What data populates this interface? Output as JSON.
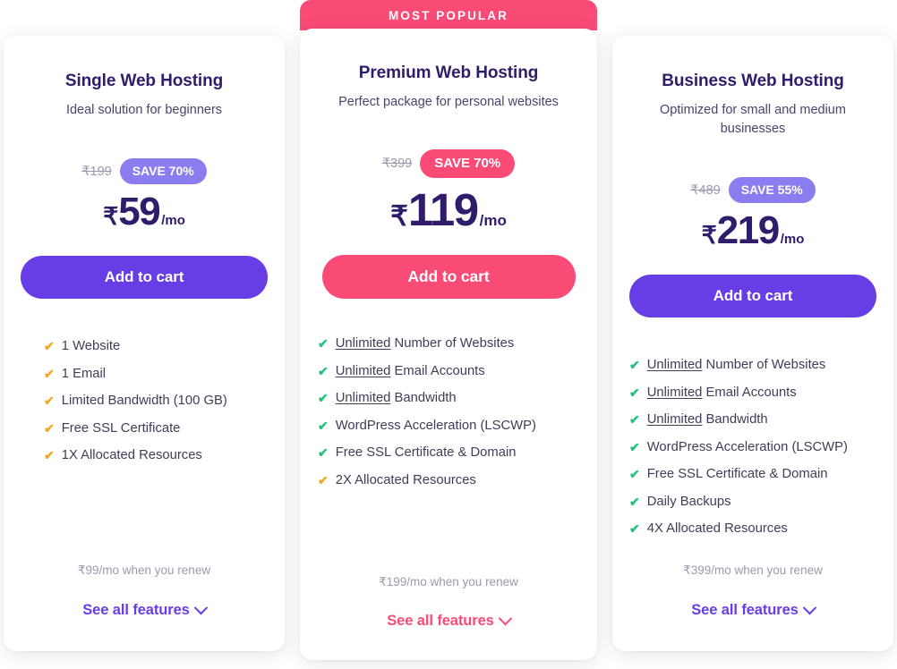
{
  "featured_ribbon": "MOST POPULAR",
  "colors": {
    "purple": "#673de6",
    "light_purple": "#8b7cf0",
    "pink": "#fa4b77",
    "title_navy": "#2f1c6a",
    "green_check": "#21c37a",
    "orange_check": "#f5a623",
    "muted": "#9a9ab0"
  },
  "plans": [
    {
      "id": "single",
      "title": "Single Web Hosting",
      "subtitle": "Ideal solution for beginners",
      "old_price": "₹199",
      "save_badge": "SAVE 70%",
      "currency": "₹",
      "amount": "59",
      "period": "/mo",
      "cta": "Add to cart",
      "features": [
        {
          "text": "1 Website",
          "emphasis": "",
          "check": "orange"
        },
        {
          "text": "1 Email",
          "emphasis": "",
          "check": "orange"
        },
        {
          "text": "Limited Bandwidth (100 GB)",
          "emphasis": "",
          "check": "orange"
        },
        {
          "text": "Free SSL Certificate",
          "emphasis": "",
          "check": "orange"
        },
        {
          "text": "1X Allocated Resources",
          "emphasis": "",
          "check": "orange"
        }
      ],
      "renew": "₹99/mo when you renew",
      "see_all": "See all features"
    },
    {
      "id": "premium",
      "title": "Premium Web Hosting",
      "subtitle": "Perfect package for personal websites",
      "old_price": "₹399",
      "save_badge": "SAVE 70%",
      "currency": "₹",
      "amount": "119",
      "period": "/mo",
      "cta": "Add to cart",
      "features": [
        {
          "text": "Number of Websites",
          "emphasis": "Unlimited",
          "check": "green"
        },
        {
          "text": "Email Accounts",
          "emphasis": "Unlimited",
          "check": "green"
        },
        {
          "text": "Bandwidth",
          "emphasis": "Unlimited",
          "check": "green"
        },
        {
          "text": "WordPress Acceleration (LSCWP)",
          "emphasis": "",
          "check": "green"
        },
        {
          "text": "Free SSL Certificate & Domain",
          "emphasis": "",
          "check": "green"
        },
        {
          "text": "2X Allocated Resources",
          "emphasis": "",
          "check": "orange"
        }
      ],
      "renew": "₹199/mo when you renew",
      "see_all": "See all features"
    },
    {
      "id": "business",
      "title": "Business Web Hosting",
      "subtitle": "Optimized for small and medium businesses",
      "old_price": "₹489",
      "save_badge": "SAVE 55%",
      "currency": "₹",
      "amount": "219",
      "period": "/mo",
      "cta": "Add to cart",
      "features": [
        {
          "text": "Number of Websites",
          "emphasis": "Unlimited",
          "check": "green"
        },
        {
          "text": "Email Accounts",
          "emphasis": "Unlimited",
          "check": "green"
        },
        {
          "text": "Bandwidth",
          "emphasis": "Unlimited",
          "check": "green"
        },
        {
          "text": "WordPress Acceleration (LSCWP)",
          "emphasis": "",
          "check": "green"
        },
        {
          "text": "Free SSL Certificate & Domain",
          "emphasis": "",
          "check": "green"
        },
        {
          "text": "Daily Backups",
          "emphasis": "",
          "check": "green"
        },
        {
          "text": "4X Allocated Resources",
          "emphasis": "",
          "check": "green"
        }
      ],
      "renew": "₹399/mo when you renew",
      "see_all": "See all features"
    }
  ]
}
